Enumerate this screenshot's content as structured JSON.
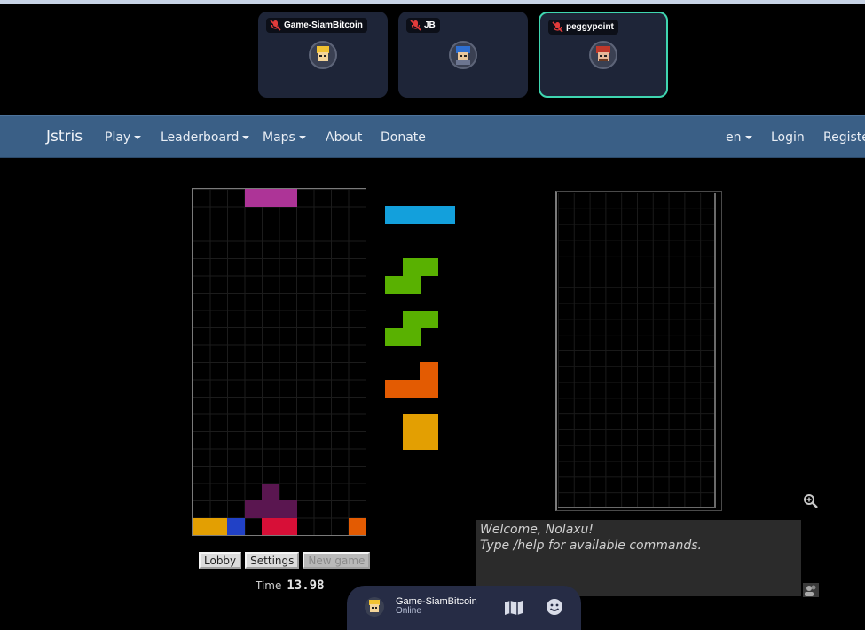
{
  "players": [
    {
      "name": "Game-SiamBitcoin",
      "muted": true,
      "active": false
    },
    {
      "name": "JB",
      "muted": true,
      "active": false
    },
    {
      "name": "peggypoint",
      "muted": true,
      "active": true
    }
  ],
  "nav": {
    "brand": "Jstris",
    "play": "Play",
    "leaderboard": "Leaderboard",
    "maps": "Maps",
    "about": "About",
    "donate": "Donate",
    "lang": "en",
    "login": "Login",
    "register": "Register"
  },
  "colors": {
    "T": "#ad3497",
    "I": "#13a0dc",
    "S": "#59b101",
    "L": "#e35b02",
    "O": "#e39f02",
    "J": "#2141c6",
    "Z": "#d70f37",
    "ghost": "#5a1650"
  },
  "board": {
    "columns": 10,
    "rows": 20,
    "active_piece": {
      "type": "T",
      "cells": [
        [
          3,
          0
        ],
        [
          4,
          0
        ],
        [
          5,
          0
        ]
      ]
    },
    "ghost_cells": [
      [
        4,
        17
      ],
      [
        3,
        18
      ],
      [
        4,
        18
      ],
      [
        5,
        18
      ]
    ],
    "locked_cells": [
      {
        "c": 0,
        "r": 19,
        "t": "O"
      },
      {
        "c": 1,
        "r": 19,
        "t": "O"
      },
      {
        "c": 2,
        "r": 19,
        "t": "J"
      },
      {
        "c": 4,
        "r": 19,
        "t": "Z"
      },
      {
        "c": 5,
        "r": 19,
        "t": "Z"
      },
      {
        "c": 9,
        "r": 19,
        "t": "L"
      }
    ]
  },
  "queue": [
    "I",
    "S",
    "S",
    "L",
    "O"
  ],
  "buttons": {
    "lobby": "Lobby",
    "settings": "Settings",
    "new_game": "New game"
  },
  "timer": {
    "label": "Time",
    "value": "13.98"
  },
  "chat": {
    "lines": [
      "Welcome, Nolaxu!",
      "Type /help for available commands."
    ]
  },
  "bottom_player": {
    "name": "Game-SiamBitcoin",
    "status": "Online"
  },
  "icons": [
    "mic-off-icon",
    "zoom-in-icon",
    "map-icon",
    "smile-icon",
    "chat-users-icon"
  ]
}
